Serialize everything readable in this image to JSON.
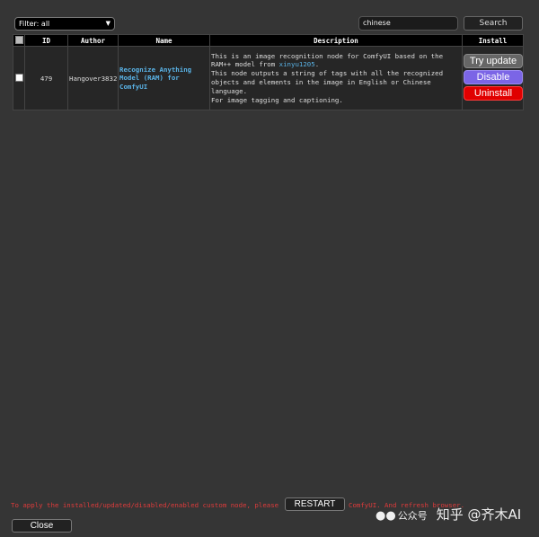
{
  "filter": {
    "selected": "Filter: all"
  },
  "search": {
    "value": "chinese",
    "button_label": "Search"
  },
  "table": {
    "headers": [
      "",
      "ID",
      "Author",
      "Name",
      "Description",
      "Install"
    ],
    "rows": [
      {
        "id": "479",
        "author": "Hangover3832",
        "name": "Recognize Anything Model (RAM) for ComfyUI",
        "desc_part1": "This is an image recognition node for ComfyUI based on the RAM++ model from ",
        "desc_link": "xinyu1205",
        "desc_part2": ".",
        "desc_line2": "This node outputs a string of tags with all the recognized objects and elements in the image in English or Chinese language.",
        "desc_line3": "For image tagging and captioning.",
        "install_buttons": [
          "Try update",
          "Disable",
          "Uninstall"
        ]
      }
    ]
  },
  "footer": {
    "note_before": "To apply the installed/updated/disabled/enabled custom node, please",
    "restart_label": "RESTART",
    "note_after": "ComfyUI. And refresh browser.",
    "close_label": "Close"
  },
  "watermark": {
    "wechat_text": "公众号",
    "zhihu_text": "知乎 @齐木AI"
  }
}
